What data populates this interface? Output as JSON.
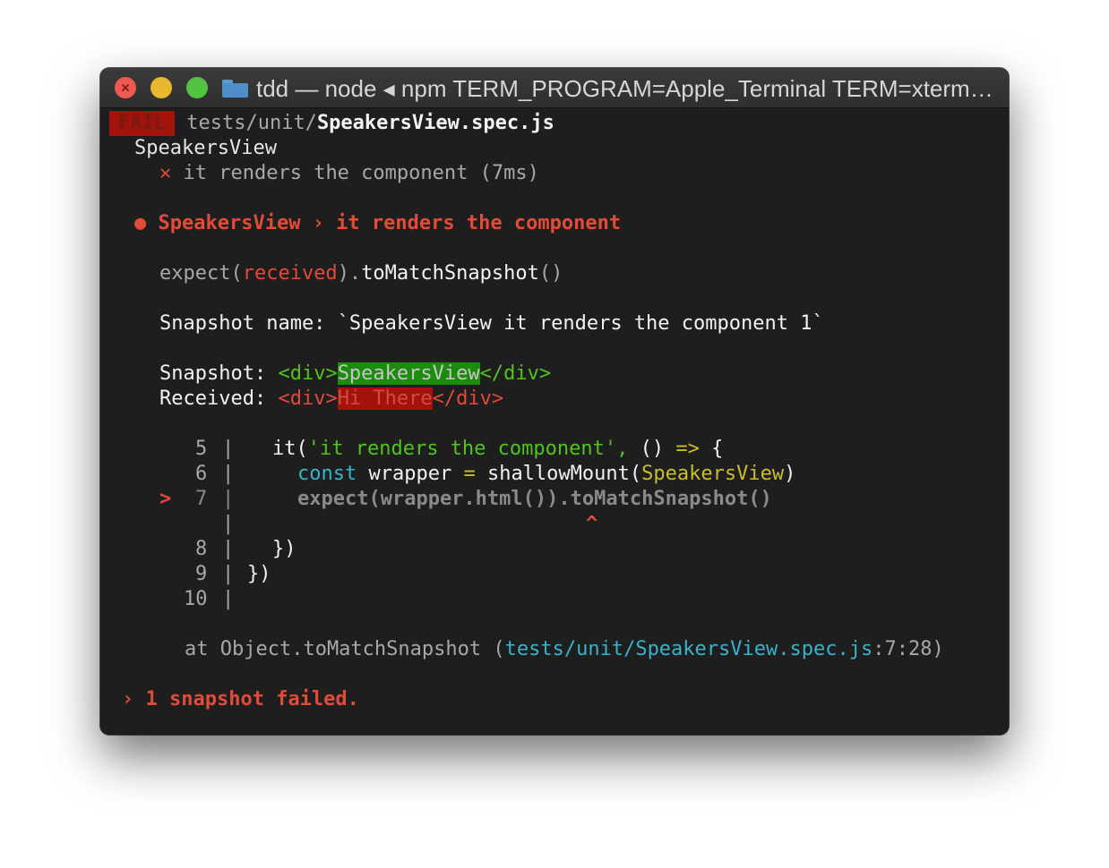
{
  "window": {
    "title": "tdd — node ◂ npm TERM_PROGRAM=Apple_Terminal TERM=xterm-…"
  },
  "terminal": {
    "fail_badge": "FAIL",
    "test_path_dir": "tests/unit/",
    "test_path_file": "SpeakersView.spec.js",
    "suite_name": "SpeakersView",
    "fail_mark": "✕",
    "test_result": "it renders the component (7ms)",
    "bullet": "●",
    "failure_header": "SpeakersView › it renders the component",
    "expect_prefix": "expect(",
    "expect_received": "received",
    "expect_mid": ").",
    "expect_method": "toMatchSnapshot",
    "expect_suffix": "()",
    "snapshot_name_label": "Snapshot name: ",
    "snapshot_name_value": "`SpeakersView it renders the component 1`",
    "snapshot_label": "Snapshot: ",
    "snapshot_open": "<div>",
    "snapshot_value": "SpeakersView",
    "snapshot_close": "</div>",
    "received_label": "Received: ",
    "received_open": "<div>",
    "received_value": "Hi There",
    "received_close": "</div>",
    "code": {
      "l5_num": "5",
      "l5_a": "it(",
      "l5_str": "'it renders the component',",
      "l5_b": " () ",
      "l5_arrow": "=>",
      "l5_c": " {",
      "l6_num": "6",
      "l6_const": "const",
      "l6_a": " wrapper ",
      "l6_eq": "=",
      "l6_b": " shallowMount(",
      "l6_arg": "SpeakersView",
      "l6_c": ")",
      "pointer": ">",
      "l7_num": "7",
      "l7_text": "expect(wrapper.html()).toMatchSnapshot()",
      "caret": "^",
      "l8_num": "8",
      "l8_text": "})",
      "l9_num": "9",
      "l9_text": "})",
      "l10_num": "10",
      "gutter": "|"
    },
    "stack_prefix": "at Object.toMatchSnapshot (",
    "stack_path": "tests/unit/SpeakersView.spec.js",
    "stack_loc": ":7:28)",
    "summary_arrow": "›",
    "summary": "1 snapshot failed."
  }
}
